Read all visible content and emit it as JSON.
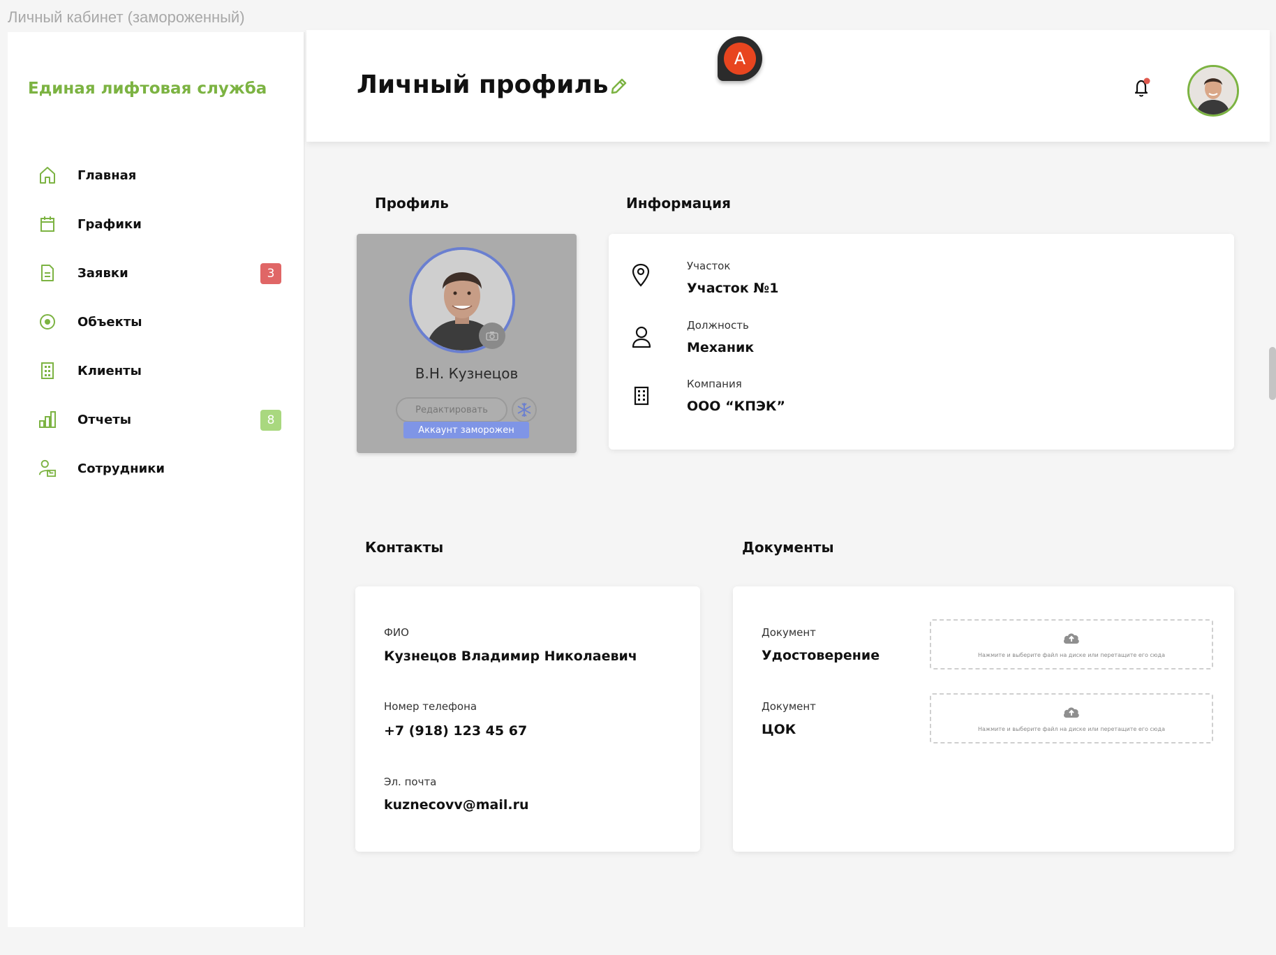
{
  "window": {
    "title": "Личный кабинет (замороженный)"
  },
  "sidebar": {
    "logo": "Единая лифтовая служба",
    "items": [
      {
        "label": "Главная",
        "icon": "home-icon"
      },
      {
        "label": "Графики",
        "icon": "calendar-icon"
      },
      {
        "label": "Заявки",
        "icon": "document-icon",
        "badge": "3",
        "badge_color": "#e06666"
      },
      {
        "label": "Объекты",
        "icon": "target-icon"
      },
      {
        "label": "Клиенты",
        "icon": "building-icon"
      },
      {
        "label": "Отчеты",
        "icon": "bar-chart-icon",
        "badge": "8",
        "badge_color": "#a9d87f"
      },
      {
        "label": "Сотрудники",
        "icon": "employee-icon"
      }
    ]
  },
  "header": {
    "title": "Личный профиль",
    "assistant_letter": "A"
  },
  "profile": {
    "section_title": "Профиль",
    "name": "В.Н. Кузнецов",
    "edit_label": "Редактировать",
    "frozen_label": "Аккаунт заморожен"
  },
  "info": {
    "section_title": "Информация",
    "fields": [
      {
        "label": "Участок",
        "value": "Участок №1"
      },
      {
        "label": "Должность",
        "value": "Механик"
      },
      {
        "label": "Компания",
        "value": "ООО “КПЭК”"
      }
    ]
  },
  "contacts": {
    "section_title": "Контакты",
    "fields": [
      {
        "label": "ФИО",
        "value": "Кузнецов Владимир Николаевич"
      },
      {
        "label": "Номер телефона",
        "value": "+7 (918) 123 45 67"
      },
      {
        "label": "Эл. почта",
        "value": "kuznecovv@mail.ru"
      }
    ]
  },
  "documents": {
    "section_title": "Документы",
    "dropzone_text": "Нажмите и выберите файл на диске или перетащите его сюда",
    "items": [
      {
        "label": "Документ",
        "value": "Удостоверение"
      },
      {
        "label": "Документ",
        "value": "ЦОК"
      }
    ]
  },
  "colors": {
    "accent": "#7cb342",
    "frozen": "#7f95e6",
    "notification_dot": "#e05a4f"
  }
}
